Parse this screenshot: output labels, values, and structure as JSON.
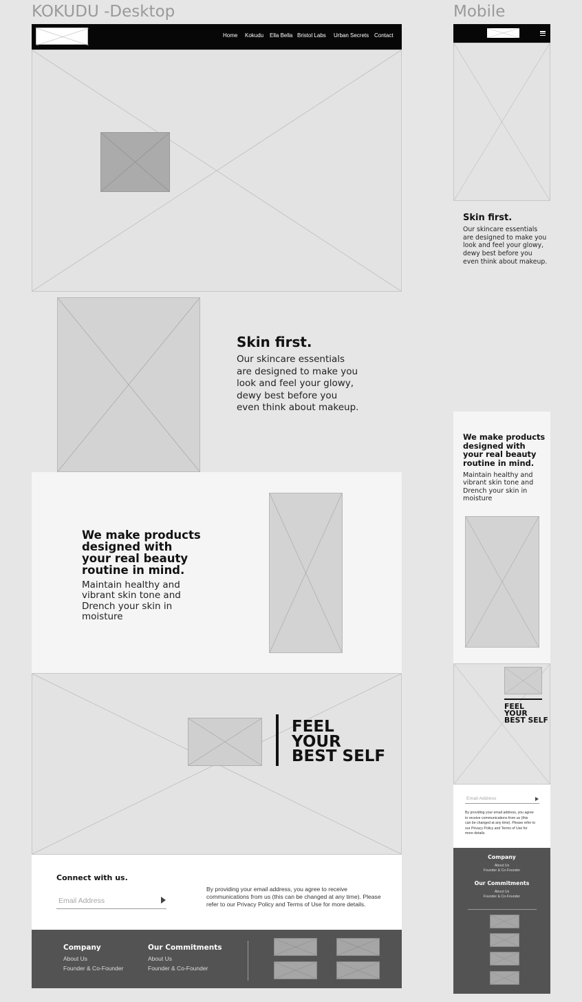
{
  "frames": {
    "desktop_title": "KOKUDU -Desktop",
    "mobile_title": "Mobile"
  },
  "nav": {
    "items": [
      "Home",
      "Kokudu",
      "Ella Bella",
      "Bristol Labs",
      "Urban Secrets",
      "Contact"
    ]
  },
  "skin": {
    "heading": "Skin first.",
    "lines": [
      "Our skincare essentials",
      "are designed to make you",
      "look and feel your glowy,",
      "dewy best before you",
      "even think about makeup."
    ]
  },
  "products": {
    "heading_lines": [
      "We make products",
      "designed with",
      "your real beauty",
      "routine in mind."
    ],
    "body_lines": [
      "Maintain healthy and",
      "vibrant skin tone and",
      "Drench your skin in",
      "moisture"
    ]
  },
  "feel": {
    "lines": [
      "FEEL",
      "YOUR",
      "BEST SELF"
    ]
  },
  "connect": {
    "heading": "Connect with us.",
    "email_placeholder": "Email Address",
    "disclaimer_lines": [
      "By providing your email address, you agree to receive",
      "communications from us (this can be changed at any time). Please",
      "refer to our Privacy Policy and Terms of Use for more details."
    ]
  },
  "footer": {
    "company": {
      "title": "Company",
      "links": [
        "About Us",
        "Founder & Co-Founder"
      ]
    },
    "commitments": {
      "title": "Our Commitments",
      "links": [
        "About Us",
        "Founder & Co-Founder"
      ]
    }
  },
  "mobile": {
    "disclaimer_lines": [
      "By providing your email address, you agree",
      "to receive communications from us (this",
      "can be changed at any time). Please refer to",
      "our Privacy Policy and Terms of Use for",
      "more details."
    ]
  }
}
